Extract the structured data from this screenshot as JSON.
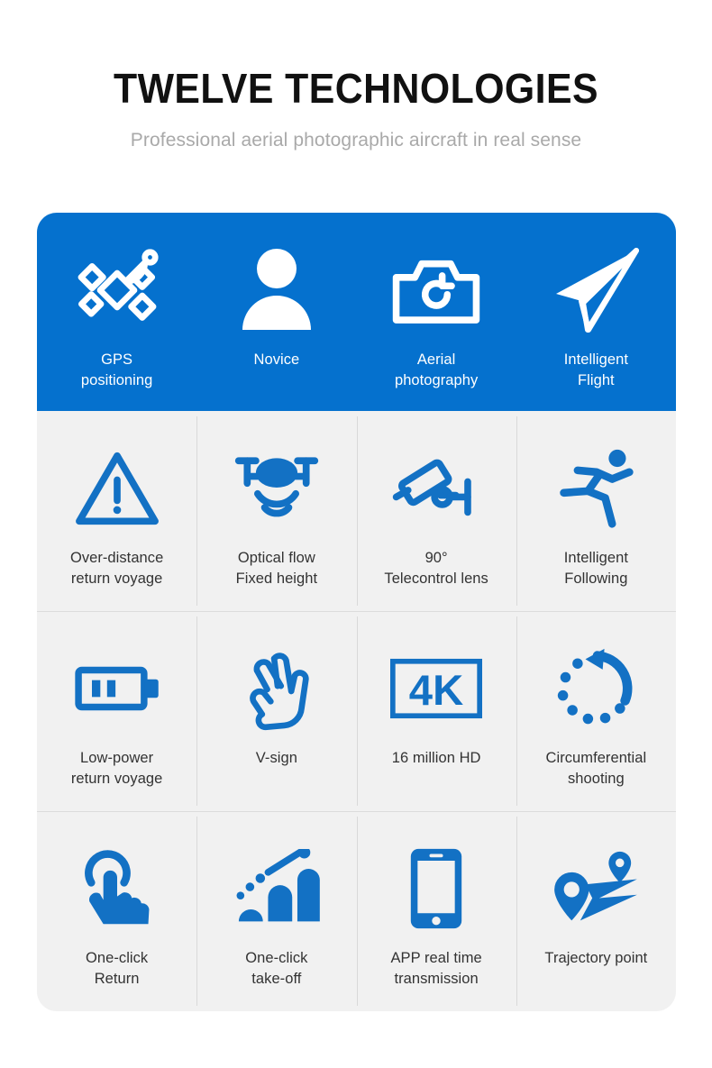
{
  "header": {
    "title": "TWELVE TECHNOLOGIES",
    "subtitle": "Professional aerial photographic aircraft in real sense"
  },
  "colors": {
    "primary_blue": "#0571ce",
    "icon_blue": "#1371c4",
    "cell_background": "#f1f1f1",
    "divider": "#d9d9d9",
    "title_color": "#111111",
    "subtitle_color": "#a9a9a9",
    "label_color": "#333333"
  },
  "features": [
    {
      "label": "GPS\npositioning",
      "line1": "GPS",
      "line2": "positioning",
      "icon": "satellite-icon",
      "highlighted": true
    },
    {
      "label": "Novice",
      "line1": "Novice",
      "line2": "",
      "icon": "person-icon",
      "highlighted": true
    },
    {
      "label": "Aerial\nphotography",
      "line1": "Aerial",
      "line2": "photography",
      "icon": "camera-icon",
      "highlighted": true
    },
    {
      "label": "Intelligent\nFlight",
      "line1": "Intelligent",
      "line2": "Flight",
      "icon": "paper-plane-icon",
      "highlighted": true
    },
    {
      "label": "Over-distance\nreturn voyage",
      "line1": "Over-distance",
      "line2": "return voyage",
      "icon": "warning-triangle-icon",
      "highlighted": false
    },
    {
      "label": "Optical flow\nFixed height",
      "line1": "Optical flow",
      "line2": "Fixed height",
      "icon": "drone-signal-icon",
      "highlighted": false
    },
    {
      "label": "90°\nTelecontrol lens",
      "line1": "90°",
      "line2": "Telecontrol lens",
      "icon": "security-camera-icon",
      "highlighted": false
    },
    {
      "label": "Intelligent\nFollowing",
      "line1": "Intelligent",
      "line2": "Following",
      "icon": "running-person-icon",
      "highlighted": false
    },
    {
      "label": "Low-power\nreturn voyage",
      "line1": "Low-power",
      "line2": "return voyage",
      "icon": "battery-icon",
      "highlighted": false
    },
    {
      "label": "V-sign",
      "line1": "V-sign",
      "line2": "",
      "icon": "v-sign-hand-icon",
      "highlighted": false
    },
    {
      "label": "16 million HD",
      "line1": "16 million HD",
      "line2": "",
      "icon": "4k-badge-icon",
      "highlighted": false
    },
    {
      "label": "Circumferential\nshooting",
      "line1": "Circumferential",
      "line2": "shooting",
      "icon": "circular-arrow-dots-icon",
      "highlighted": false
    },
    {
      "label": "One-click\nReturn",
      "line1": "One-click",
      "line2": "Return",
      "icon": "tap-gesture-icon",
      "highlighted": false
    },
    {
      "label": "One-click\ntake-off",
      "line1": "One-click",
      "line2": "take-off",
      "icon": "ascending-bars-icon",
      "highlighted": false
    },
    {
      "label": "APP real time\ntransmission",
      "line1": "APP real time",
      "line2": "transmission",
      "icon": "smartphone-icon",
      "highlighted": false
    },
    {
      "label": "Trajectory point",
      "line1": "Trajectory point",
      "line2": "",
      "icon": "route-pins-icon",
      "highlighted": false
    }
  ]
}
